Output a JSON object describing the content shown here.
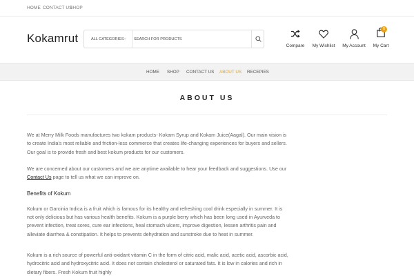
{
  "topbar": {
    "links": [
      "HOME",
      "CONTACT US",
      "SHOP"
    ]
  },
  "header": {
    "logo": "Kokamrut",
    "category_select": "ALL CATEGORIES",
    "search_placeholder": "SEARCH FOR PRODUCTS",
    "icons": {
      "compare": {
        "label": "Compare",
        "icon": "shuffle-icon"
      },
      "wishlist": {
        "label": "My Wishlist",
        "icon": "heart-icon"
      },
      "account": {
        "label": "My Account",
        "icon": "user-icon"
      },
      "cart": {
        "label": "My Cart",
        "icon": "shopping-bag-icon",
        "count": "0"
      }
    }
  },
  "nav": {
    "items": [
      "HOME",
      "SHOP",
      "CONTACT US",
      "ABOUT US",
      "RECEPIES"
    ],
    "active": "ABOUT US"
  },
  "page": {
    "title": "ABOUT US",
    "intro": "We at Merry Milk Foods manufactures two kokam products- Kokam Syrup and Kokam Juice(Aagal). Our main vision is to create India's most reliable and friction-less commerce that creates life-changing experiences for buyers and sellers. Our goal is to provide fresh and best kokum products for our customers.",
    "concern_before": "We are concerned about our customers and we are anytime available to hear your feedback and suggestions. Use our ",
    "concern_link": "Contact Us",
    "concern_after": " page to tell us what we can improve on.",
    "benefits_heading": "Benefits of Kokum",
    "benefits_text": "Kokum or Garcinia Indica is a fruit which is famous for its healthy and refreshing cool drink especially in summer. It is not only delicious but has various health benefits. Kokum is a purple berry which has been long used in Ayurveda to prevent infection, treat sores, cure ear infections, heal stomach ulcers, improve digestion, lessen arthritis pain and alleviate diarrhea & constipation. It helps to prevents dehydration and sunstroke due to heat in summer.",
    "vitamin_text": "Kokum is a rich source of powerful anti-oxidant vitamin C in the form of citric acid, malic acid, acetic acid, ascorbic acid, hydrocitric acid and hydroxycitric acid. It does not contain cholesterol or saturated fats. It is low in calories and rich in dietary fibers. Fresh Kokum fruit highly"
  },
  "colors": {
    "accent": "#e0a622",
    "badge": "#e8a317",
    "navbar_bg": "#f2f2f2"
  }
}
